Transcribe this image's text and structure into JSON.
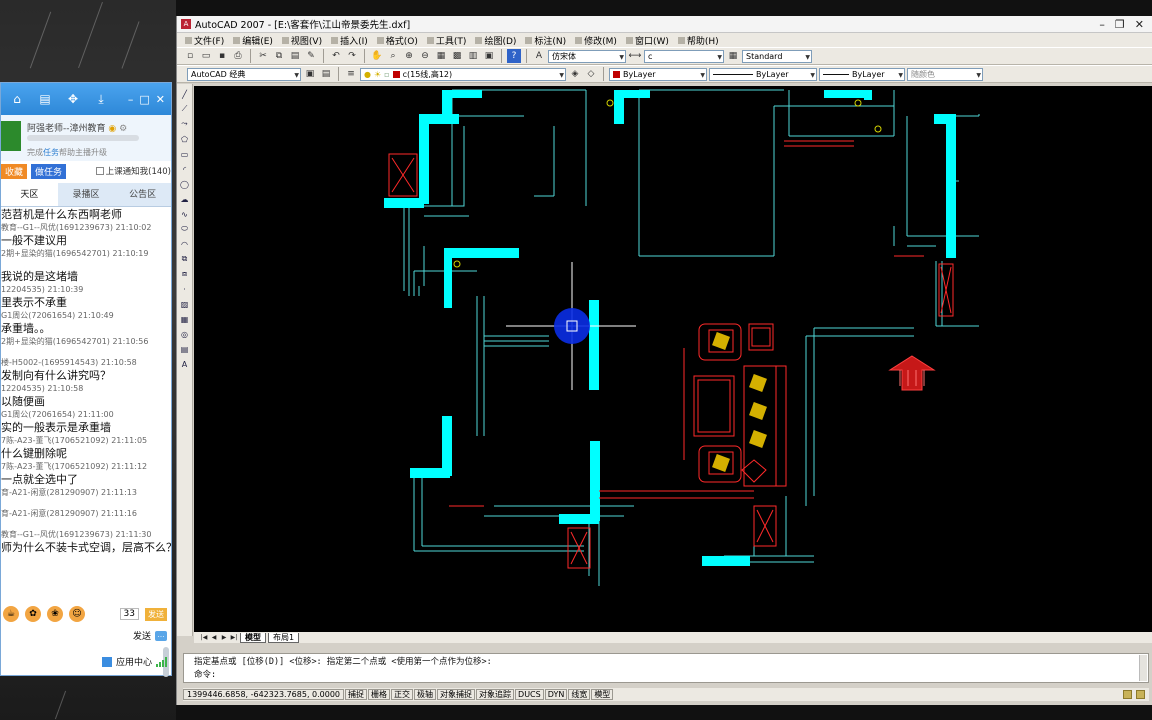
{
  "qq": {
    "tabs": [
      "天区",
      "录播区",
      "公告区"
    ],
    "active_tab": 0,
    "profile_name": "阿强老师--漳州教育",
    "profile_sub_prefix": "完成",
    "profile_sub_link": "任务",
    "profile_sub_suffix": "帮助主播升级",
    "btn_collect": "收藏",
    "btn_task": "做任务",
    "checkbox_label": "上课通知我(140)",
    "messages": [
      {
        "meta": "",
        "text": "范苕机是什么东西啊老师"
      },
      {
        "meta": "教育--G1--风优(1691239673) 21:10:02",
        "text": "一般不建议用"
      },
      {
        "meta": "2期+显染的猫(1696542701) 21:10:19",
        "text": ""
      },
      {
        "meta": "",
        "text": "我说的是这堵墙"
      },
      {
        "meta": "12204535) 21:10:39",
        "text": "里表示不承重"
      },
      {
        "meta": "G1周公(72061654) 21:10:49",
        "text": "承重墙。。"
      },
      {
        "meta": "2期+显染的猫(1696542701) 21:10:56",
        "text": ""
      },
      {
        "meta": "楼-H5002-(1695914543) 21:10:58",
        "text": "发制向有什么讲究吗？"
      },
      {
        "meta": "12204535) 21:10:58",
        "text": "以随便画"
      },
      {
        "meta": "G1周公(72061654) 21:11:00",
        "text": "实的一般表示是承重墙"
      },
      {
        "meta": "7陈-A23-董飞(1706521092) 21:11:05",
        "text": "什么键删除呢"
      },
      {
        "meta": "7陈-A23-董飞(1706521092) 21:11:12",
        "text": "一点就全选中了"
      },
      {
        "meta": "育-A21-闲意(281290907) 21:11:13",
        "text": ""
      },
      {
        "meta": "育-A21-闲意(281290907) 21:11:16",
        "text": ""
      },
      {
        "meta": "教育--G1--风优(1691239673) 21:11:30",
        "text": "师为什么不装卡式空调，层高不么？"
      }
    ],
    "font_size": "33",
    "send_mini": "发送",
    "send_label": "发送",
    "app_center": "应用中心"
  },
  "acad": {
    "title": "AutoCAD 2007 - [E:\\客套作\\江山帝景委先生.dxf]",
    "menus": [
      "文件(F)",
      "编辑(E)",
      "视图(V)",
      "插入(I)",
      "格式(O)",
      "工具(T)",
      "绘图(D)",
      "标注(N)",
      "修改(M)",
      "窗口(W)",
      "帮助(H)"
    ],
    "text_style": "仿宋体",
    "dim_style_sel": "c",
    "style_name": "Standard",
    "workspace": "AutoCAD 经典",
    "layer_name": "c(15线,高12)",
    "color_sel": "ByLayer",
    "linetype_sel": "ByLayer",
    "lineweight_sel": "ByLayer",
    "plotstyle_sel": "随颜色",
    "layout_tabs": [
      "模型",
      "布局1"
    ],
    "active_layout": 0,
    "command_line1": "指定基点或 [位移(D)] <位移>:  指定第二个点或 <使用第一个点作为位移>:",
    "command_prompt": "命令:",
    "coords": "1399446.6858, -642323.7685, 0.0000",
    "status_buttons": [
      "捕捉",
      "栅格",
      "正交",
      "极轴",
      "对象捕捉",
      "对象追踪",
      "DUCS",
      "DYN",
      "线宽",
      "模型"
    ]
  },
  "colors": {
    "cyan_wall": "#00ffff",
    "red_furniture": "#ff2a2a",
    "arrow_red": "#c61818",
    "cursor_blue": "#0a2ee6",
    "qq_blue": "#2e88d8"
  }
}
